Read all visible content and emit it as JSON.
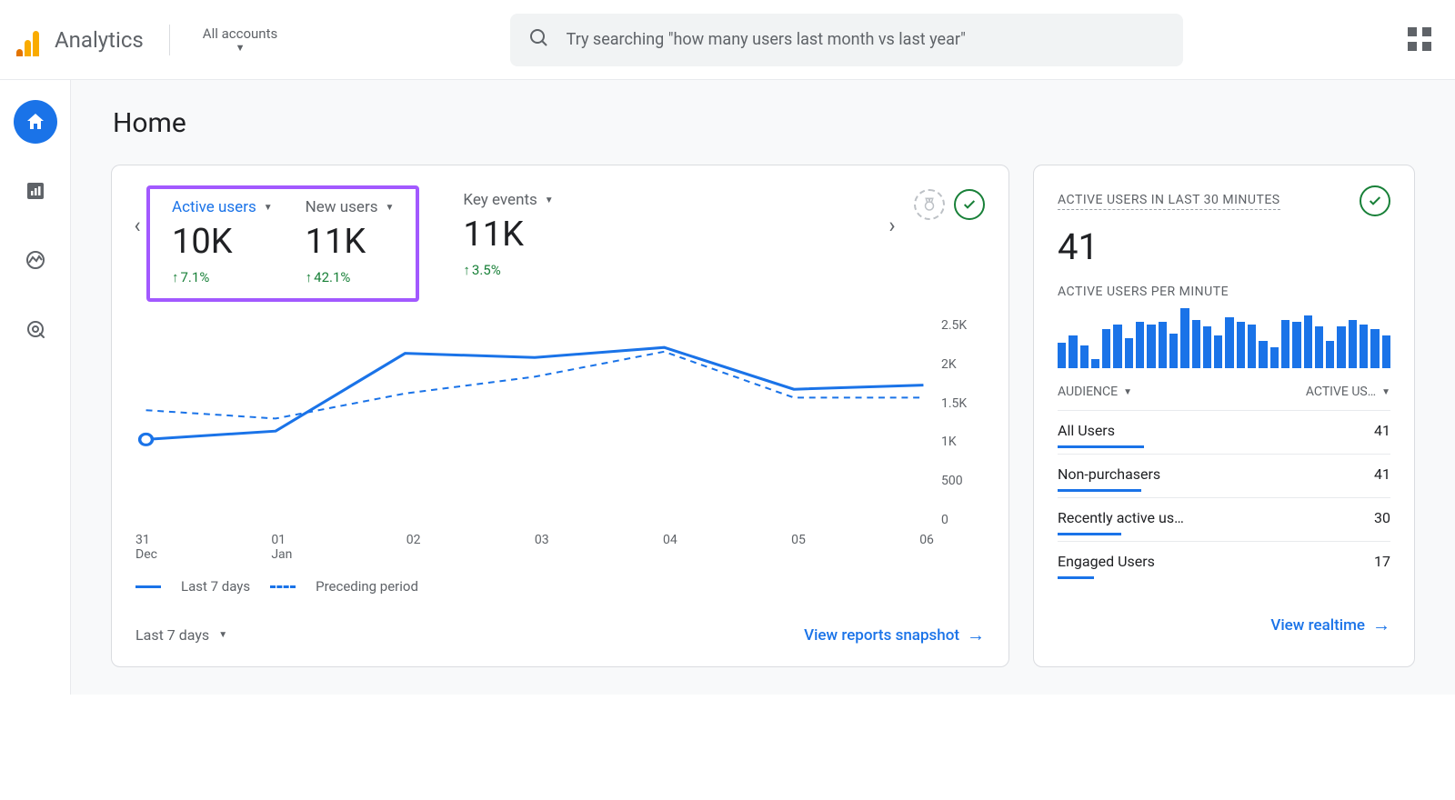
{
  "header": {
    "brand": "Analytics",
    "account_label": "All accounts",
    "search_placeholder": "Try searching \"how many users last month vs last year\""
  },
  "page": {
    "title": "Home"
  },
  "metrics": [
    {
      "label": "Active users",
      "value": "10K",
      "delta": "7.1%",
      "highlighted": true,
      "color": "blue"
    },
    {
      "label": "New users",
      "value": "11K",
      "delta": "42.1%",
      "highlighted": true
    },
    {
      "label": "Key events",
      "value": "11K",
      "delta": "3.5%"
    }
  ],
  "chart_data": {
    "type": "line",
    "title": "",
    "xlabel": "",
    "ylabel": "",
    "ylim": [
      0,
      2500
    ],
    "y_ticks": [
      "2.5K",
      "2K",
      "1.5K",
      "1K",
      "500",
      "0"
    ],
    "categories": [
      "31 Dec",
      "01 Jan",
      "02",
      "03",
      "04",
      "05",
      "06"
    ],
    "series": [
      {
        "name": "Last 7 days",
        "values": [
          1050,
          1150,
          2080,
          2030,
          2150,
          1650,
          1700
        ]
      },
      {
        "name": "Preceding period",
        "values": [
          1400,
          1300,
          1600,
          1800,
          2100,
          1550,
          1550
        ]
      }
    ],
    "legend": [
      "Last 7 days",
      "Preceding period"
    ]
  },
  "main_card": {
    "range_label": "Last 7 days",
    "view_link": "View reports snapshot"
  },
  "realtime": {
    "title": "ACTIVE USERS IN LAST 30 MINUTES",
    "value": "41",
    "per_minute_title": "ACTIVE USERS PER MINUTE",
    "per_minute_values": [
      22,
      28,
      20,
      8,
      34,
      38,
      26,
      40,
      38,
      40,
      30,
      52,
      42,
      36,
      28,
      44,
      40,
      38,
      24,
      18,
      42,
      40,
      46,
      36,
      24,
      36,
      42,
      38,
      34,
      28
    ],
    "columns": {
      "audience": "AUDIENCE",
      "active": "ACTIVE US…"
    },
    "rows": [
      {
        "label": "All Users",
        "value": "41",
        "bar": 100
      },
      {
        "label": "Non-purchasers",
        "value": "41",
        "bar": 99
      },
      {
        "label": "Recently active us…",
        "value": "30",
        "bar": 73
      },
      {
        "label": "Engaged Users",
        "value": "17",
        "bar": 41
      }
    ],
    "view_link": "View realtime"
  }
}
